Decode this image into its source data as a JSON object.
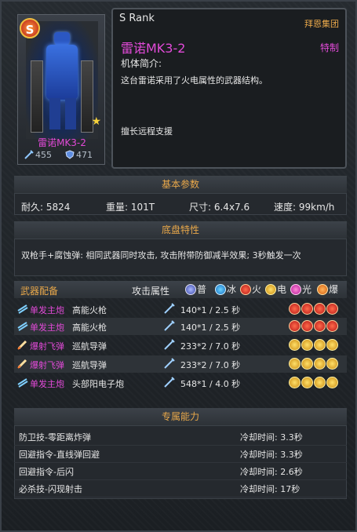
{
  "card": {
    "rank_badge": "S",
    "name": "雷诺MK3-2",
    "atk": "455",
    "def": "471"
  },
  "info": {
    "rank": "S Rank",
    "maker": "拜恩集团",
    "name": "雷诺MK3-2",
    "special": "特制",
    "intro_label": "机体简介:",
    "intro": "这台雷诺采用了火电属性的武器结构。",
    "skill": "擅长远程支援"
  },
  "basic": {
    "title": "基本参数",
    "durability": "耐久: 5824",
    "weight": "重量: 101T",
    "size": "尺寸: 6.4x7.6",
    "speed": "速度: 99km/h"
  },
  "chassis": {
    "title": "底盘特性",
    "text": "双枪手+腐蚀弹: 相同武器同时攻击, 攻击附带防御减半效果; 3秒触发一次"
  },
  "weapons": {
    "title": "武器配备",
    "attack_attr": "攻击属性",
    "legend": [
      "普",
      "冰",
      "火",
      "电",
      "光",
      "爆"
    ],
    "rows": [
      {
        "type": "单发主炮",
        "name": "高能火枪",
        "value": "140*1 / 2.5 秒",
        "orbs": "fire"
      },
      {
        "type": "单发主炮",
        "name": "高能火枪",
        "value": "140*1 / 2.5 秒",
        "orbs": "fire"
      },
      {
        "type": "爆射飞弹",
        "name": "巡航导弹",
        "value": "233*2 / 7.0 秒",
        "orbs": "elec"
      },
      {
        "type": "爆射飞弹",
        "name": "巡航导弹",
        "value": "233*2 / 7.0 秒",
        "orbs": "elec"
      },
      {
        "type": "单发主炮",
        "name": "头部阳电子炮",
        "value": "548*1 / 4.0 秒",
        "orbs": "elec"
      }
    ]
  },
  "skills": {
    "title": "专属能力",
    "rows": [
      {
        "name": "防卫技-零距离炸弹",
        "cd": "冷却时间: 3.3秒"
      },
      {
        "name": "回避指令-直线弹回避",
        "cd": "冷却时间: 3.3秒"
      },
      {
        "name": "回避指令-后闪",
        "cd": "冷却时间: 2.6秒"
      },
      {
        "name": "必杀技-闪现射击",
        "cd": "冷却时间: 17秒"
      }
    ]
  }
}
